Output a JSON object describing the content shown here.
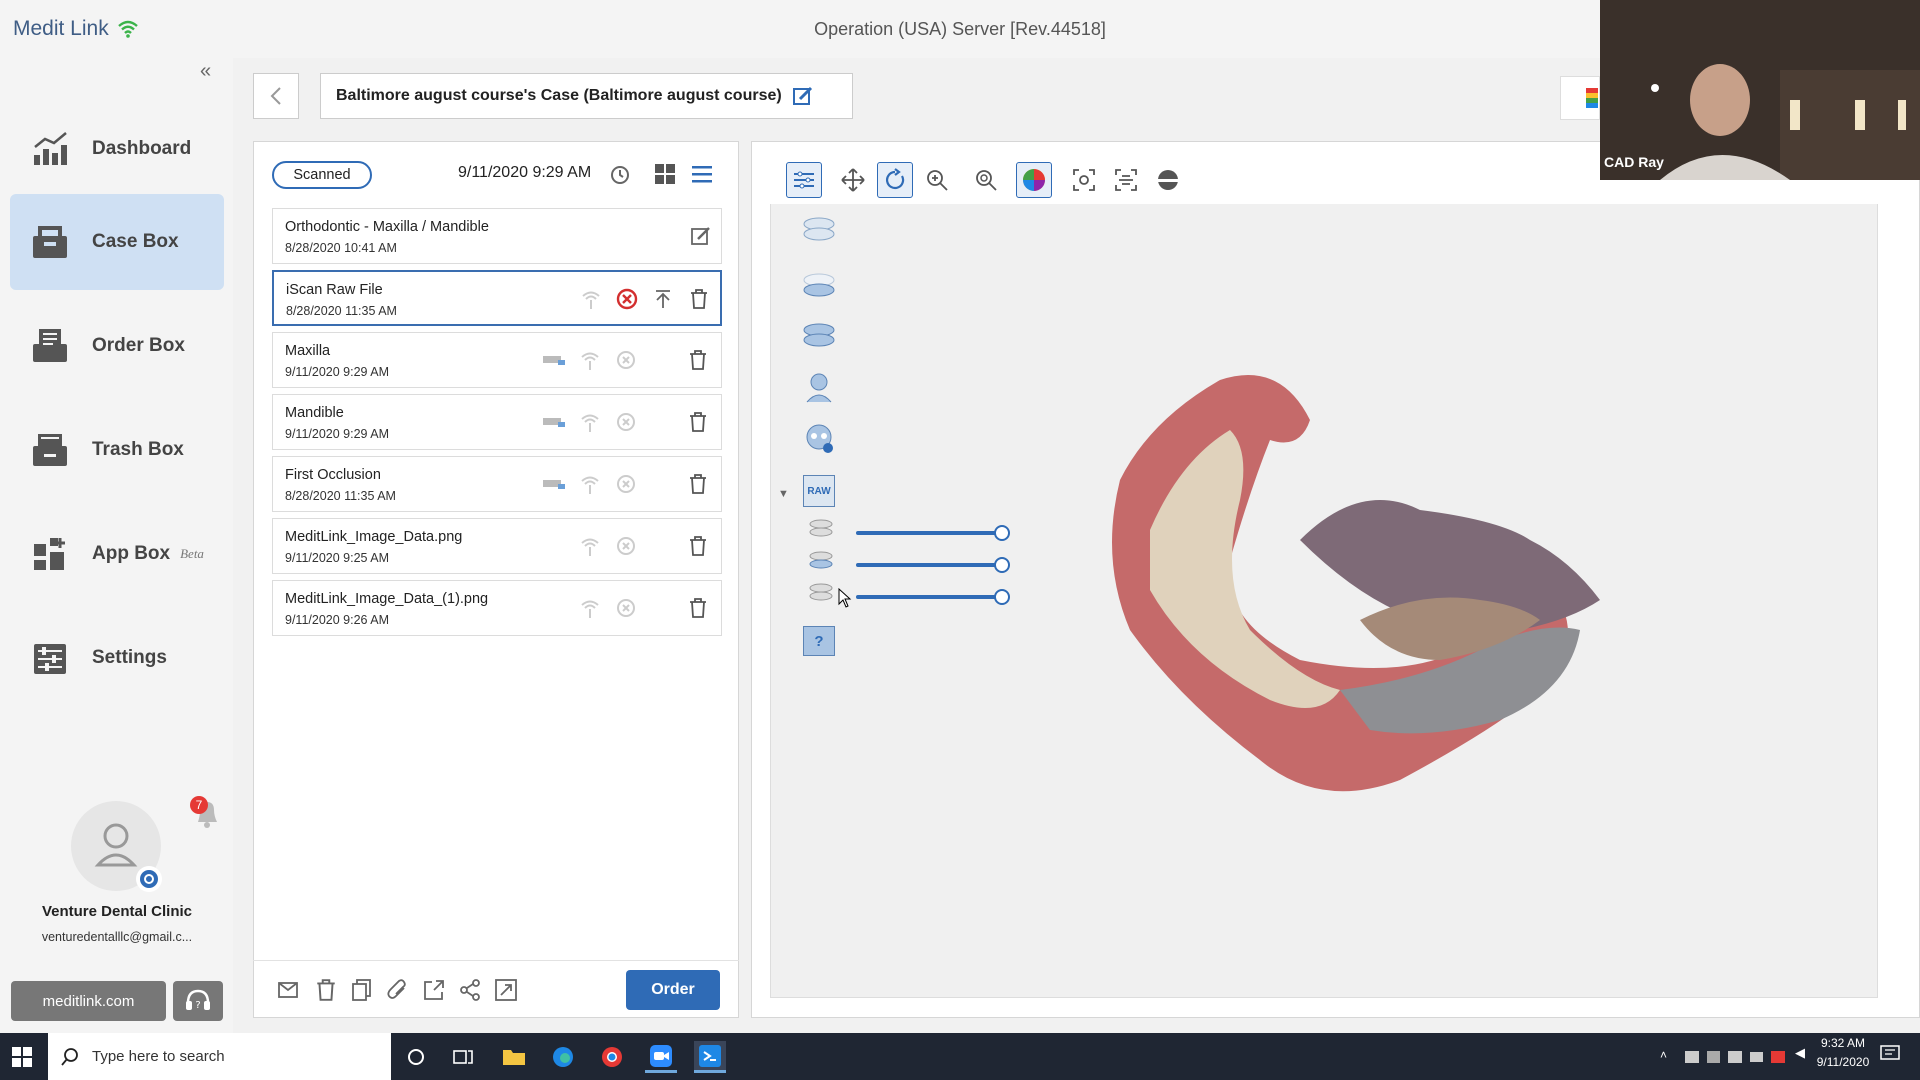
{
  "app": {
    "brand": "Medit Link",
    "server": "Operation (USA) Server [Rev.44518]"
  },
  "sidebar": {
    "items": [
      {
        "label": "Dashboard",
        "icon": "dashboard-icon"
      },
      {
        "label": "Case Box",
        "icon": "case-box-icon",
        "active": true
      },
      {
        "label": "Order Box",
        "icon": "order-box-icon"
      },
      {
        "label": "Trash Box",
        "icon": "trash-box-icon"
      },
      {
        "label": "App Box",
        "badge": "Beta",
        "icon": "app-box-icon"
      },
      {
        "label": "Settings",
        "icon": "settings-icon"
      }
    ],
    "notification_count": "7",
    "clinic_name": "Venture Dental Clinic",
    "clinic_email": "venturedentalllc@gmail.c...",
    "website_button": "meditlink.com"
  },
  "case": {
    "title": "Baltimore august course's Case (Baltimore august course)",
    "status": "Scanned",
    "datetime": "9/11/2020 9:29 AM",
    "files": [
      {
        "name": "Orthodontic - Maxilla / Mandible",
        "date": "8/28/2020 10:41 AM"
      },
      {
        "name": "iScan Raw File",
        "date": "8/28/2020 11:35 AM"
      },
      {
        "name": "Maxilla",
        "date": "9/11/2020 9:29 AM"
      },
      {
        "name": "Mandible",
        "date": "9/11/2020 9:29 AM"
      },
      {
        "name": "First Occlusion",
        "date": "8/28/2020 11:35 AM"
      },
      {
        "name": "MeditLink_Image_Data.png",
        "date": "9/11/2020 9:25 AM"
      },
      {
        "name": "MeditLink_Image_Data_(1).png",
        "date": "9/11/2020 9:26 AM"
      }
    ],
    "order_button": "Order"
  },
  "viewer": {
    "layer_buttons": [
      "RAW",
      "?"
    ],
    "sliders": [
      1.0,
      1.0,
      1.0
    ]
  },
  "webcam": {
    "name": "CAD Ray"
  },
  "taskbar": {
    "search_placeholder": "Type here to search",
    "time": "9:32 AM",
    "date": "9/11/2020"
  },
  "colors": {
    "accent": "#2f6bb6",
    "active_nav": "#cfe0f3",
    "taskbar": "#1f2633"
  }
}
